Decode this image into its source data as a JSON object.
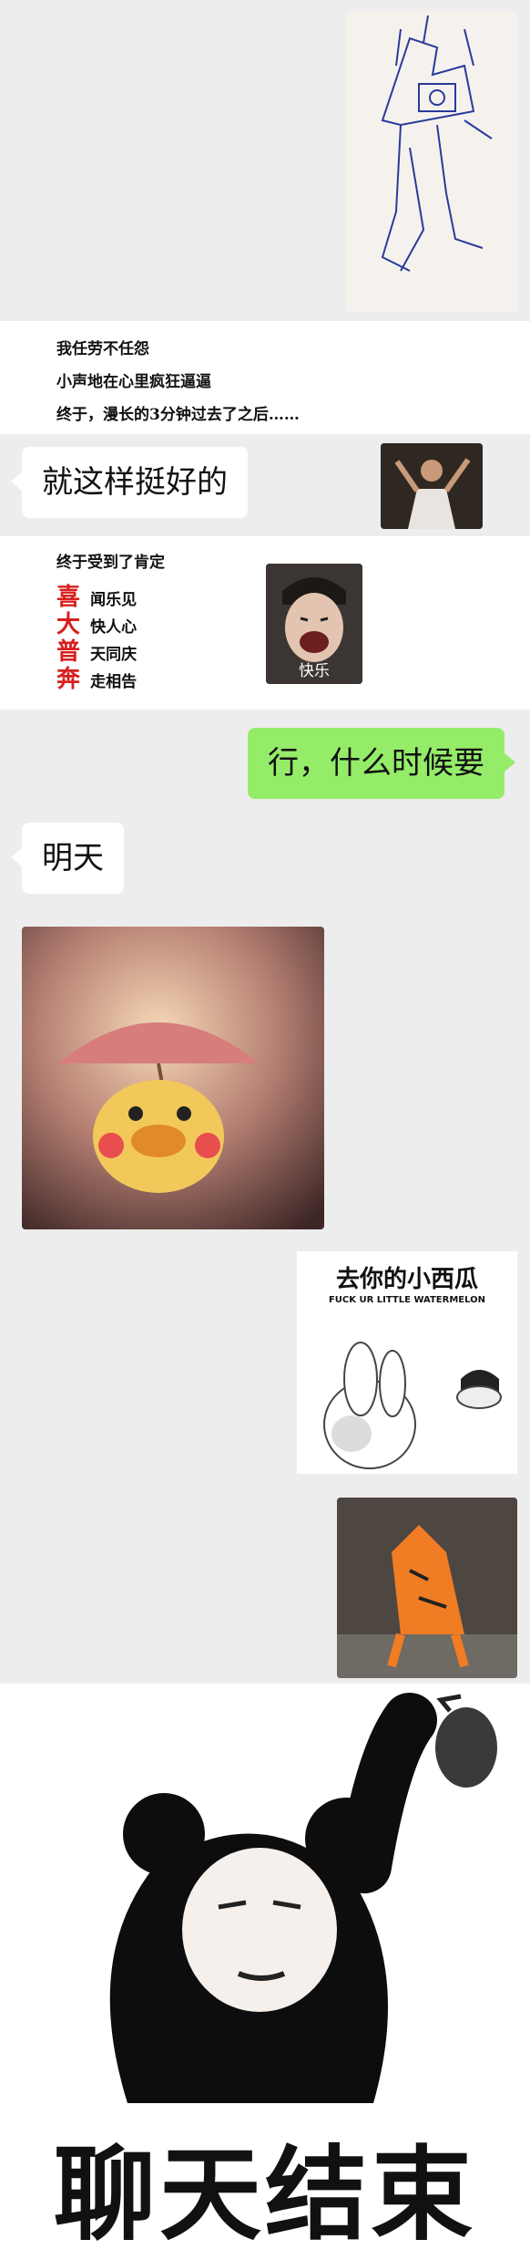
{
  "poem": {
    "line1": "我任劳不任怨",
    "line2": "小声地在心里疯狂逼逼",
    "line3": "终于，漫长的3分钟过去了之后……"
  },
  "messages": {
    "m1": "就这样挺好的",
    "m2": "行，什么时候要",
    "m3": "明天"
  },
  "praise": {
    "header": "终于受到了肯定",
    "rows": [
      {
        "red": "喜",
        "rest": "闻乐见"
      },
      {
        "red": "大",
        "rest": "快人心"
      },
      {
        "red": "普",
        "rest": "天同庆"
      },
      {
        "red": "奔",
        "rest": "走相告"
      }
    ],
    "sticker_caption": "快乐"
  },
  "sticker_melon": {
    "title": "去你的小西瓜",
    "subtitle": "FUCK UR LITTLE WATERMELON"
  },
  "ending": {
    "text": "聊天结束"
  },
  "colors": {
    "chat_bg": "#ededed",
    "right_bubble": "#95ec69",
    "left_bubble": "#ffffff",
    "accent_red": "#d6201e"
  }
}
